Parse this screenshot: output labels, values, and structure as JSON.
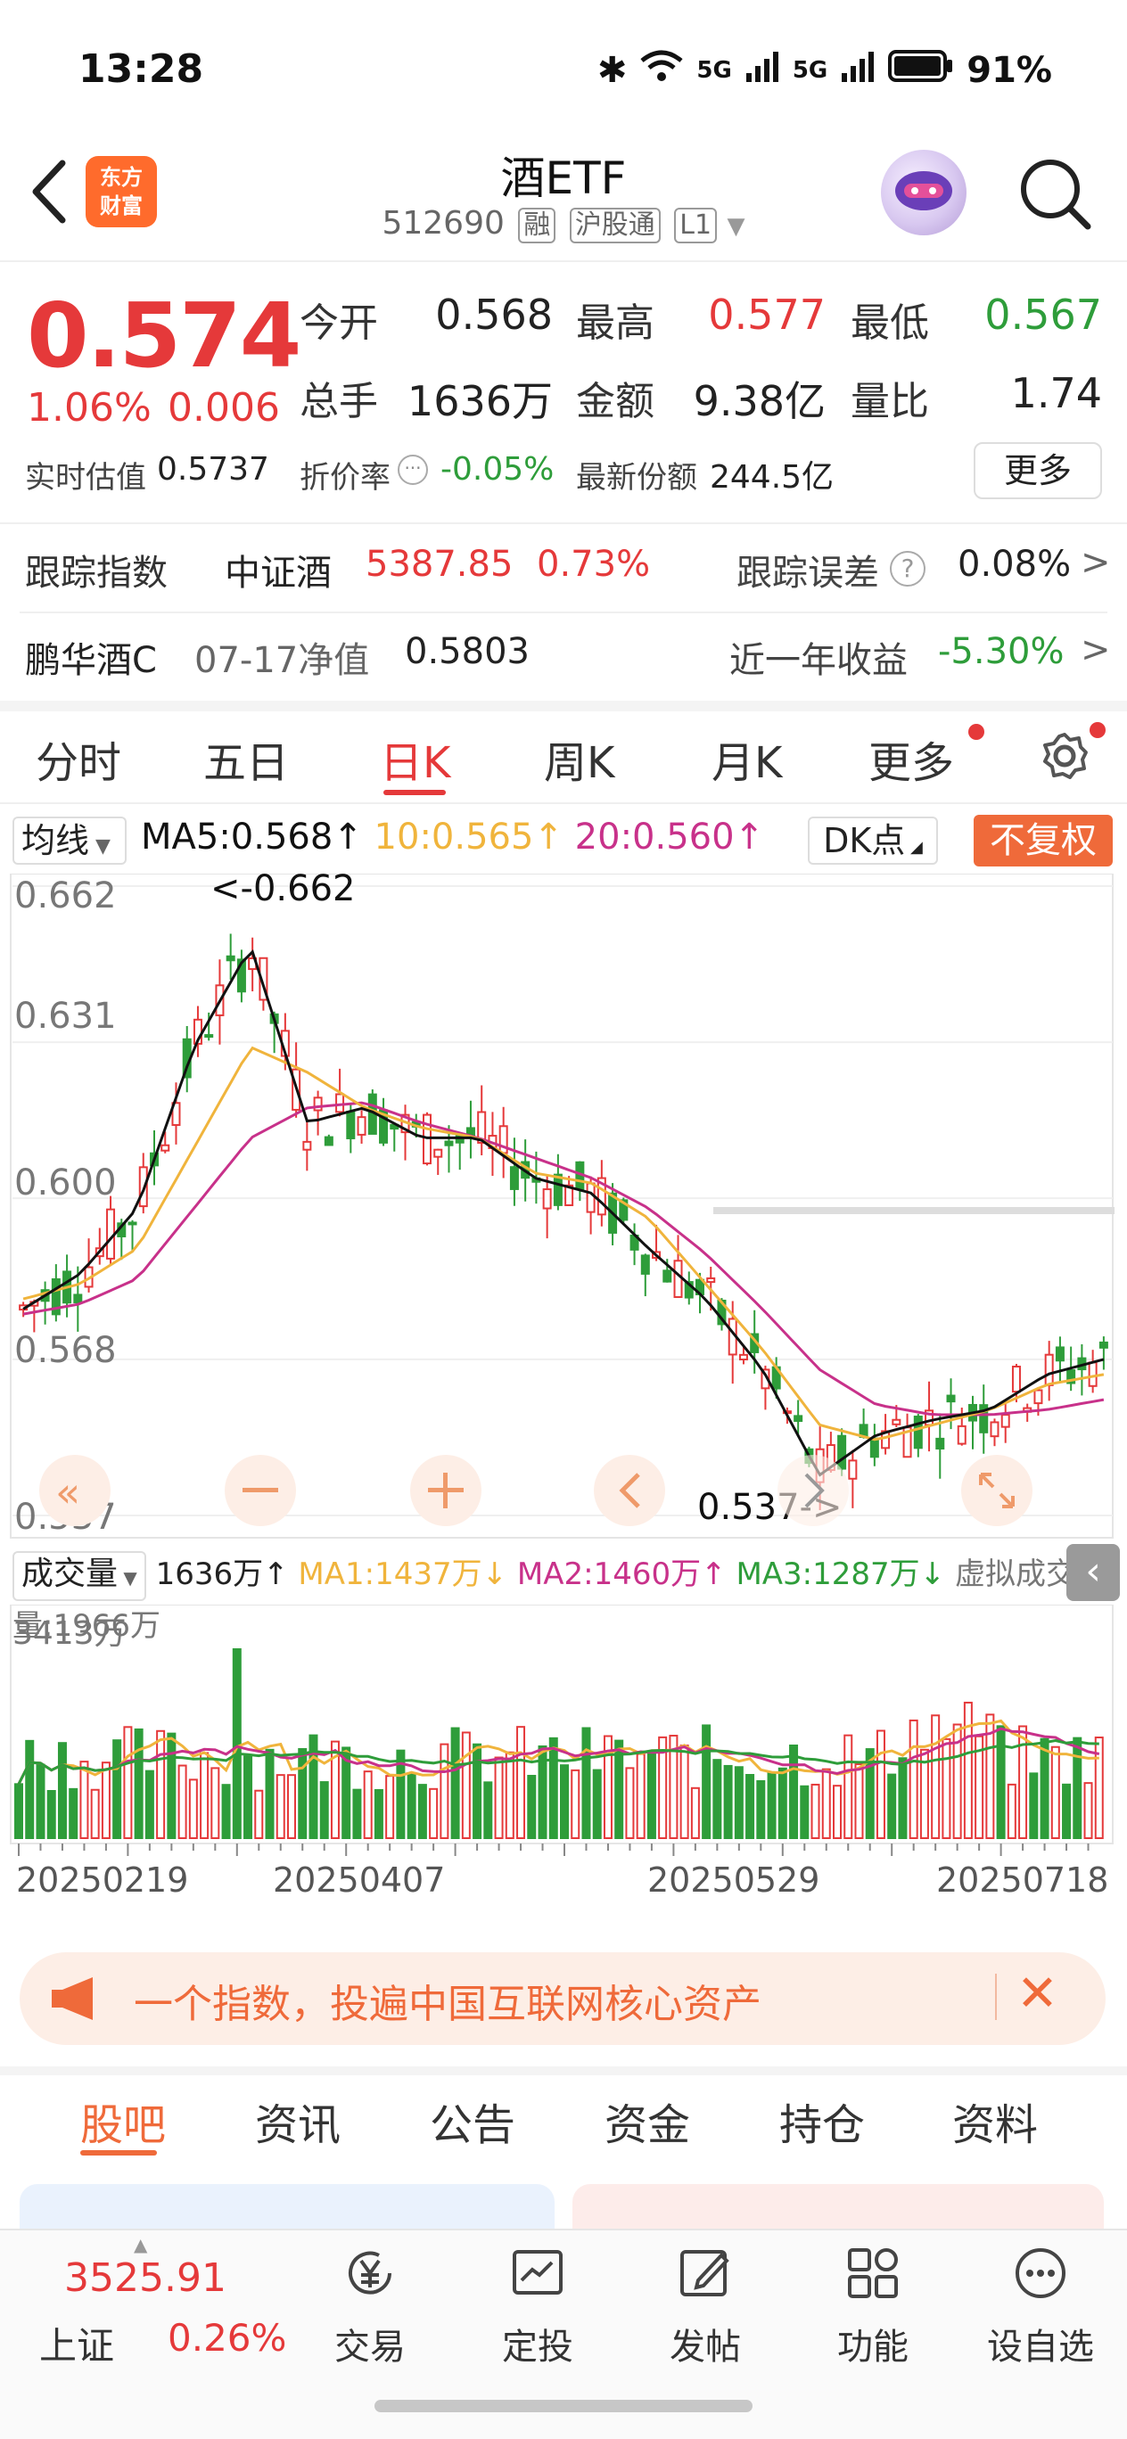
{
  "status": {
    "time": "13:28",
    "battery": "91%",
    "network1": "5G",
    "network2": "5G"
  },
  "header": {
    "title": "酒ETF",
    "code": "512690",
    "tags": [
      "融",
      "沪股通",
      "L1"
    ],
    "brand": [
      "东方",
      "财富"
    ]
  },
  "quote": {
    "price": "0.574",
    "change_pct": "1.06%",
    "change_abs": "0.006",
    "open_label": "今开",
    "open": "0.568",
    "high_label": "最高",
    "high": "0.577",
    "low_label": "最低",
    "low": "0.567",
    "volume_label": "总手",
    "volume": "1636万",
    "amount_label": "金额",
    "amount": "9.38亿",
    "ratio_label": "量比",
    "ratio": "1.74",
    "iopv_label": "实时估值",
    "iopv": "0.5737",
    "premium_label": "折价率",
    "premium": "-0.05%",
    "shares_label": "最新份额",
    "shares": "244.5亿",
    "more_label": "更多"
  },
  "tracking": {
    "label": "跟踪指数",
    "index_name": "中证酒",
    "index_value": "5387.85",
    "index_pct": "0.73%",
    "error_label": "跟踪误差",
    "error_value": "0.08%"
  },
  "fund": {
    "name": "鹏华酒C",
    "nav_date_label": "07-17净值",
    "nav": "0.5803",
    "yield_label": "近一年收益",
    "yield": "-5.30%"
  },
  "kline_tabs": [
    "分时",
    "五日",
    "日K",
    "周K",
    "月K",
    "更多"
  ],
  "ma_legend": {
    "select": "均线",
    "ma5": "MA5:0.568↑",
    "ma10": "10:0.565↑",
    "ma20": "20:0.560↑",
    "dk": "DK点",
    "adjust": "不复权"
  },
  "chart": {
    "y_labels": [
      "0.662",
      "0.631",
      "0.600",
      "0.568",
      "0.537"
    ],
    "max_label": "<-0.662",
    "min_label": "0.537->"
  },
  "volume": {
    "select": "成交量",
    "value": "1636万↑",
    "ma1": "MA1:1437万↓",
    "ma2": "MA2:1460万↑",
    "ma3": "MA3:1287万↓",
    "virtual": "虚拟成交量:1966万",
    "max_label": "3413万",
    "dates": [
      "20250219",
      "20250407",
      "20250529",
      "20250718"
    ]
  },
  "colors": {
    "up": "#e5393a",
    "down": "#2e9d3a",
    "ma5": "#111111",
    "ma10": "#f0b43c",
    "ma20": "#c8318a",
    "accent": "#ef6a3a"
  },
  "banner": {
    "text": "一个指数，投遍中国互联网核心资产"
  },
  "section_tabs": [
    "股吧",
    "资讯",
    "公告",
    "资金",
    "持仓",
    "资料"
  ],
  "bottom_nav": {
    "index_value": "3525.91",
    "index_name": "上证",
    "index_pct": "0.26%",
    "items": [
      {
        "label": "交易",
        "icon": "yen-icon"
      },
      {
        "label": "定投",
        "icon": "chart-board-icon"
      },
      {
        "label": "发帖",
        "icon": "edit-icon"
      },
      {
        "label": "功能",
        "icon": "grid-icon"
      },
      {
        "label": "设自选",
        "icon": "more-dots-icon"
      }
    ]
  },
  "chart_data": {
    "type": "candlestick",
    "x": [
      "20250219",
      "20250407",
      "20250529",
      "20250718"
    ],
    "ylim": [
      0.537,
      0.662
    ],
    "series": [
      {
        "name": "MA5",
        "values": [
          0.578,
          0.585,
          0.598,
          0.63,
          0.65,
          0.615,
          0.618,
          0.612,
          0.612,
          0.604,
          0.601,
          0.59,
          0.58,
          0.566,
          0.545,
          0.553,
          0.556,
          0.558,
          0.565,
          0.568
        ]
      },
      {
        "name": "MA10",
        "values": [
          0.58,
          0.583,
          0.59,
          0.61,
          0.63,
          0.625,
          0.618,
          0.614,
          0.612,
          0.605,
          0.603,
          0.596,
          0.583,
          0.57,
          0.555,
          0.552,
          0.555,
          0.558,
          0.563,
          0.565
        ]
      },
      {
        "name": "MA20",
        "values": [
          0.577,
          0.579,
          0.584,
          0.598,
          0.612,
          0.618,
          0.619,
          0.615,
          0.612,
          0.608,
          0.604,
          0.598,
          0.589,
          0.578,
          0.566,
          0.559,
          0.557,
          0.557,
          0.558,
          0.56
        ]
      }
    ]
  }
}
